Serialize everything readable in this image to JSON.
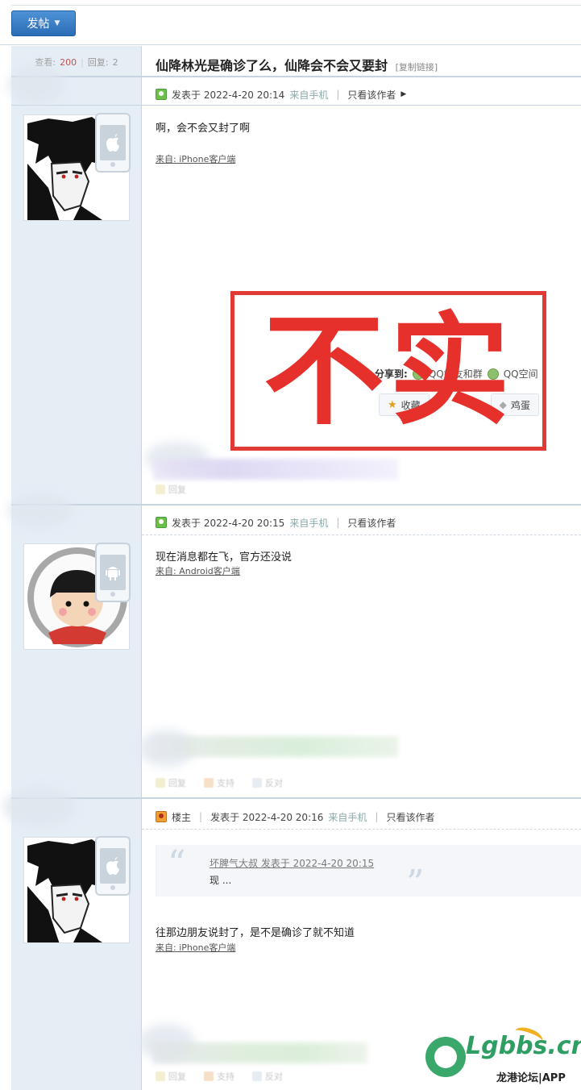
{
  "toolbar": {
    "post_button": "发帖"
  },
  "thread": {
    "views_label": "查看:",
    "views": "200",
    "replies_label": "回复:",
    "replies": "2",
    "title": "仙降林光是确诊了么，仙降会不会又要封",
    "copy_link": "[复制链接]"
  },
  "posts": [
    {
      "posted": "发表于 2022-4-20 20:14",
      "source": "来自手机",
      "author_only": "只看该作者",
      "content": "啊，会不会又封了啊",
      "client": "来自: iPhone客户端"
    },
    {
      "posted": "发表于 2022-4-20 20:15",
      "source": "来自手机",
      "author_only": "只看该作者",
      "content": "现在消息都在飞，官方还没说",
      "client": "来自: Android客户端"
    },
    {
      "floor": "楼主",
      "posted": "发表于 2022-4-20 20:16",
      "source": "来自手机",
      "author_only": "只看该作者",
      "quote_author": "坏脾气大叔 发表于 2022-4-20 20:15",
      "quote_text": "现 ...",
      "content": "往那边朋友说封了，是不是确诊了就不知道",
      "client": "来自: iPhone客户端"
    }
  ],
  "share": {
    "label": "分享到:",
    "qq_friends": "QQ好友和群",
    "qzone": "QQ空间",
    "favorite": "收藏",
    "egg": "鸡蛋"
  },
  "actions": {
    "reply": "回复",
    "support": "支持",
    "oppose": "反对"
  },
  "stamp": {
    "text": "不实",
    "color": "#e6302b"
  },
  "watermark": {
    "brand": "Lgbbs.cn",
    "sub": "龙港论坛|APP"
  }
}
